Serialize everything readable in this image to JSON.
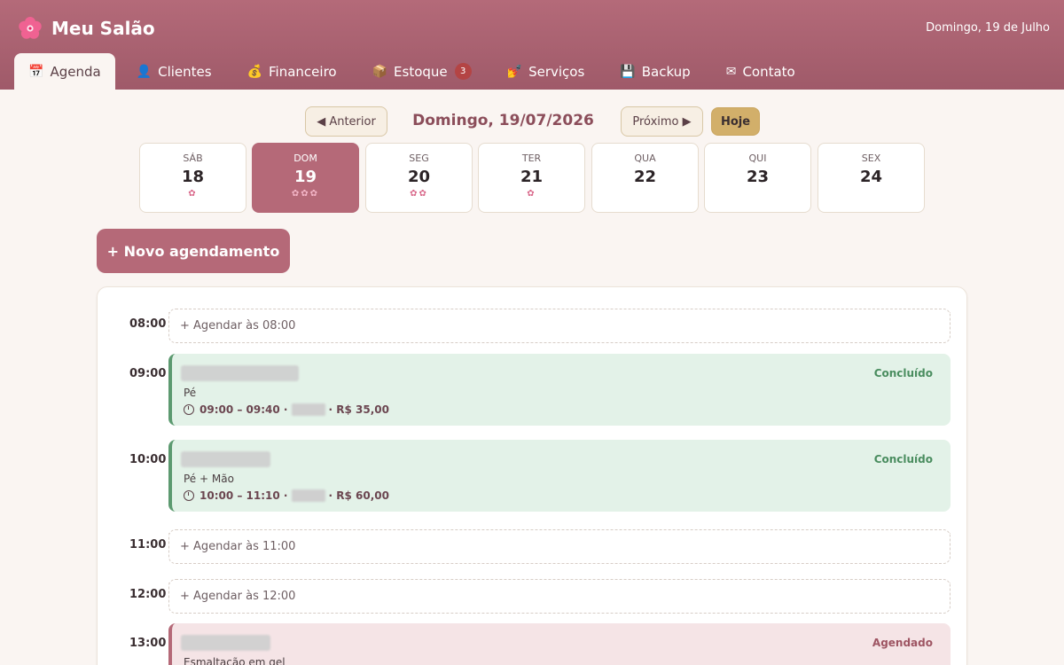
{
  "app": {
    "title": "Meu Salão",
    "header_date": "Domingo, 19 de Julho",
    "brand_icon": "flower-icon"
  },
  "tabs": [
    {
      "label": "Agenda",
      "icon": "calendar-icon",
      "glyph": "📅",
      "active": true
    },
    {
      "label": "Clientes",
      "icon": "user-icon",
      "glyph": "👤"
    },
    {
      "label": "Financeiro",
      "icon": "money-bag-icon",
      "glyph": "💰"
    },
    {
      "label": "Estoque",
      "icon": "box-icon",
      "glyph": "📦",
      "badge": "3"
    },
    {
      "label": "Serviços",
      "icon": "nail-polish-icon",
      "glyph": "💅"
    },
    {
      "label": "Backup",
      "icon": "floppy-disk-icon",
      "glyph": "💾"
    },
    {
      "label": "Contato",
      "icon": "envelope-icon",
      "glyph": "✉"
    }
  ],
  "nav": {
    "prev": "◀ Anterior",
    "next": "Próximo ▶",
    "today": "Hoje",
    "current_date": "Domingo, 19/07/2026"
  },
  "week": [
    {
      "dow": "SÁB",
      "num": "18",
      "dots": "✿"
    },
    {
      "dow": "DOM",
      "num": "19",
      "dots": "✿✿✿",
      "active": true
    },
    {
      "dow": "SEG",
      "num": "20",
      "dots": "✿✿"
    },
    {
      "dow": "TER",
      "num": "21",
      "dots": "✿"
    },
    {
      "dow": "QUA",
      "num": "22",
      "dots": ""
    },
    {
      "dow": "QUI",
      "num": "23",
      "dots": ""
    },
    {
      "dow": "SEX",
      "num": "24",
      "dots": ""
    }
  ],
  "new_appointment": "+ Novo agendamento",
  "slots": [
    {
      "time": "08:00",
      "type": "empty",
      "label": "+ Agendar às 08:00"
    },
    {
      "time": "09:00",
      "type": "appt",
      "status_class": "done",
      "service": "Pé",
      "range": "09:00 – 09:40 ·",
      "price": "· R$ 35,00",
      "status": "Concluído"
    },
    {
      "time": "10:00",
      "type": "appt",
      "status_class": "done",
      "service": "Pé + Mão",
      "range": "10:00 – 11:10 ·",
      "price": "· R$ 60,00",
      "status": "Concluído"
    },
    {
      "time": "11:00",
      "type": "empty",
      "label": "+ Agendar às 11:00"
    },
    {
      "time": "12:00",
      "type": "empty",
      "label": "+ Agendar às 12:00"
    },
    {
      "time": "13:00",
      "type": "appt",
      "status_class": "sched",
      "service": "Esmaltação em gel",
      "range": "",
      "price": "",
      "status": "Agendado"
    }
  ]
}
